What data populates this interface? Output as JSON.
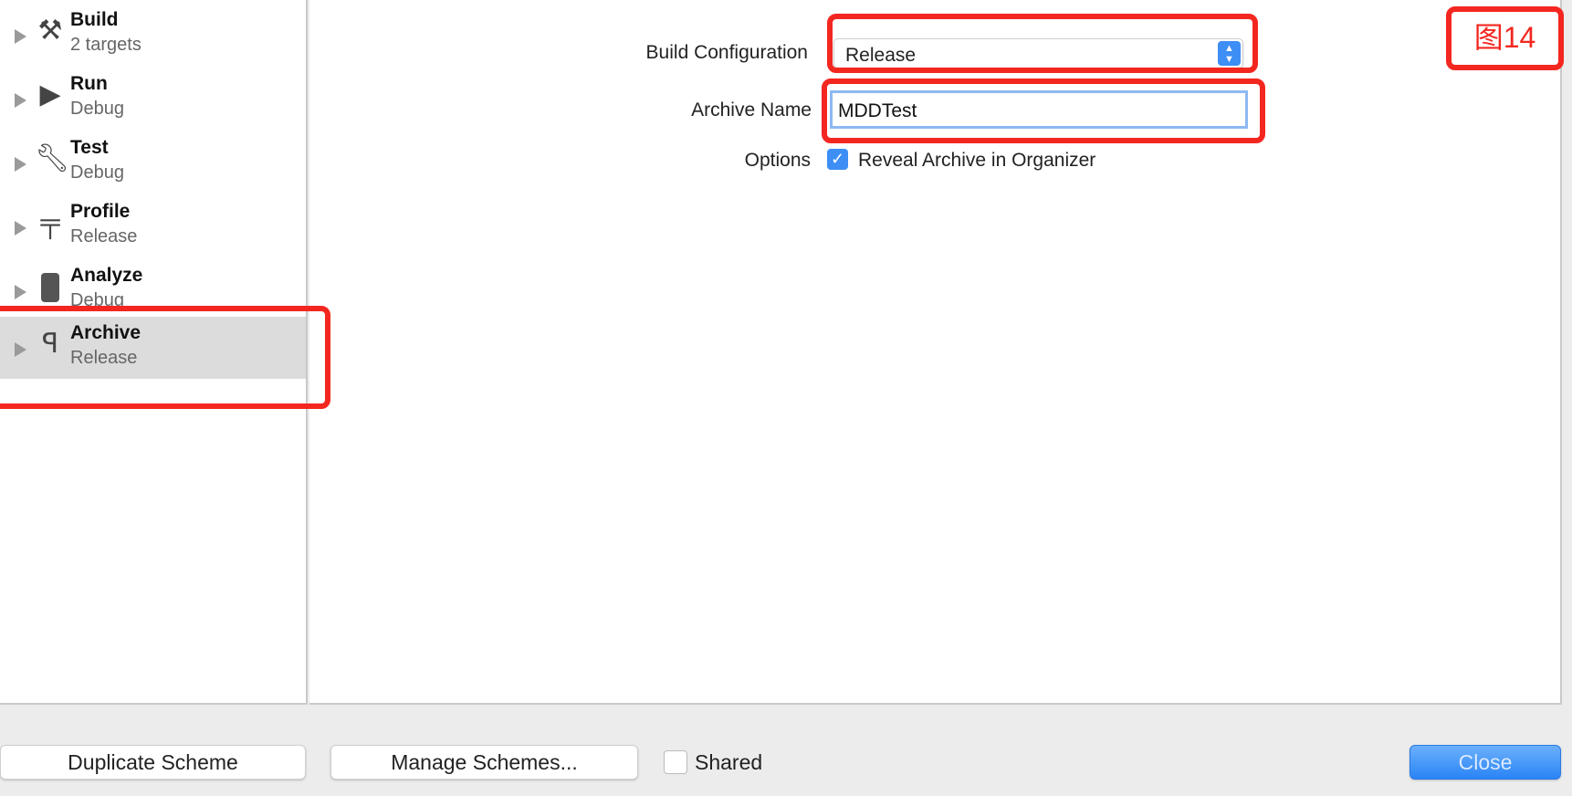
{
  "sidebar": {
    "items": [
      {
        "title": "Build",
        "subtitle": "2 targets",
        "icon": "hammer-icon"
      },
      {
        "title": "Run",
        "subtitle": "Debug",
        "icon": "play-icon"
      },
      {
        "title": "Test",
        "subtitle": "Debug",
        "icon": "wrench-icon"
      },
      {
        "title": "Profile",
        "subtitle": "Release",
        "icon": "caliper-icon"
      },
      {
        "title": "Analyze",
        "subtitle": "Debug",
        "icon": "analyze-icon"
      },
      {
        "title": "Archive",
        "subtitle": "Release",
        "icon": "archive-icon",
        "selected": true
      }
    ]
  },
  "form": {
    "build_configuration_label": "Build Configuration",
    "build_configuration_value": "Release",
    "archive_name_label": "Archive Name",
    "archive_name_value": "MDDTest",
    "options_label": "Options",
    "reveal_label": "Reveal Archive in Organizer",
    "reveal_checked": true
  },
  "footer": {
    "duplicate": "Duplicate Scheme",
    "manage": "Manage Schemes...",
    "shared": "Shared",
    "shared_checked": false,
    "close": "Close"
  },
  "annotation": {
    "label": "图14",
    "color": "#f3271f"
  },
  "colors": {
    "accent": "#3d8ef5",
    "highlight": "#f3271f"
  }
}
